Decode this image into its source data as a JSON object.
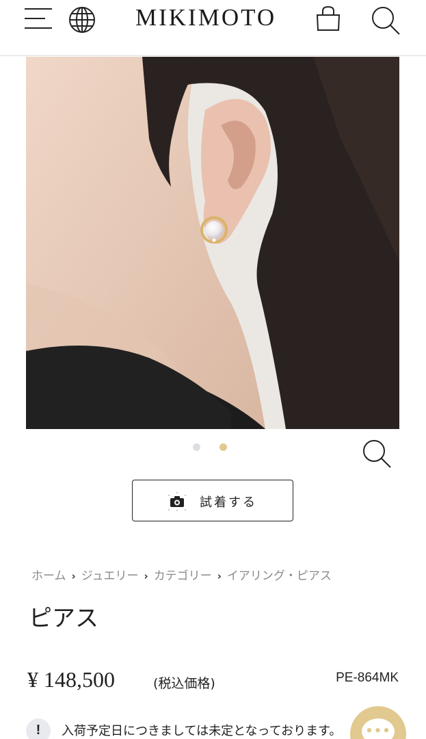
{
  "header": {
    "logo": "MIKIMOTO",
    "icons": [
      "menu-icon",
      "globe-icon",
      "shopping-bag-icon",
      "search-icon"
    ]
  },
  "gallery": {
    "slide_count": 2,
    "active_slide": 2,
    "zoom_icon": "magnifier-icon"
  },
  "try_on": {
    "label": "試着する",
    "icon": "camera-icon"
  },
  "breadcrumb": [
    "ホーム",
    "ジュエリー",
    "カテゴリー",
    "イアリング・ピアス"
  ],
  "product": {
    "title": "ピアス",
    "price": "¥ 148,500",
    "tax_note": "(税込価格)",
    "sku": "PE-864MK"
  },
  "notice": {
    "icon_label": "!",
    "text": "入荷予定日につきましては未定となっております。"
  },
  "chat": {
    "icon": "chat-bubble-icon",
    "dots": "•••"
  },
  "colors": {
    "accent_gold": "#e1c98f",
    "text": "#222222",
    "muted": "#8a8a8a"
  }
}
